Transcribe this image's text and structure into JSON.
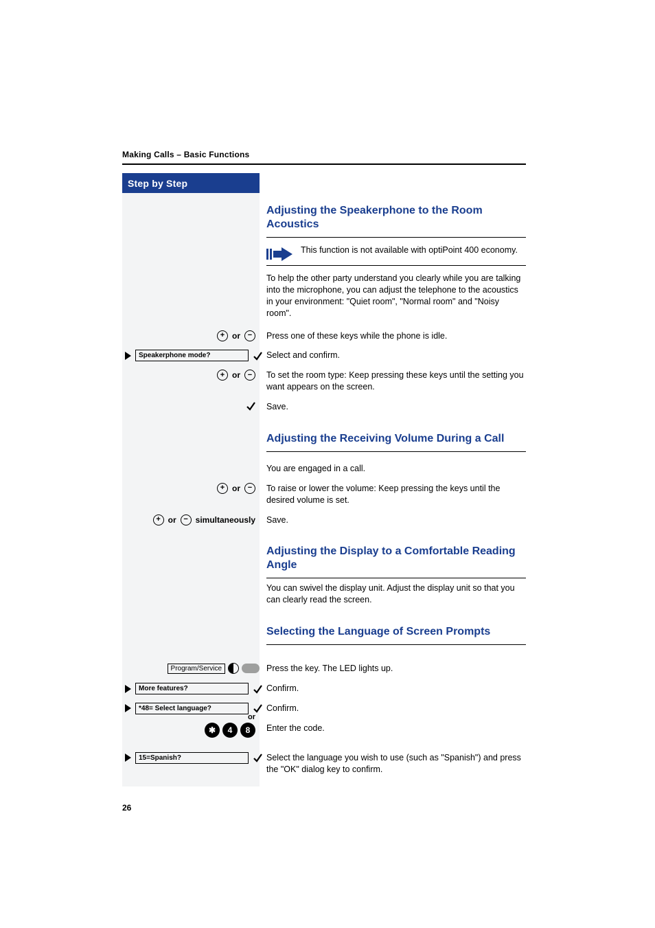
{
  "running_head": "Making Calls – Basic Functions",
  "step_heading": "Step by Step",
  "page_number": "26",
  "sections": {
    "s1": {
      "title": "Adjusting the Speakerphone to the Room Acoustics",
      "note": "This function is not available with optiPoint 400 economy.",
      "intro": "To help the other party understand you clearly while you are talking into the microphone, you can adjust the telephone to the acoustics in your environment: \"Quiet room\", \"Normal room\" and \"Noisy room\".",
      "step1": "Press one of these keys while the phone is idle.",
      "disp1": "Speakerphone mode?",
      "step2": "Select and confirm.",
      "step3": "To set the room type: Keep pressing these keys until the setting you want appears on the screen.",
      "step4": "Save."
    },
    "s2": {
      "title": "Adjusting the Receiving Volume During a Call",
      "intro": "You are engaged in a call.",
      "step1": "To raise or lower the volume: Keep pressing the keys until the desired volume is set.",
      "simul_label": "simultaneously",
      "step2": "Save."
    },
    "s3": {
      "title": "Adjusting the Display to a Comfortable Reading Angle",
      "intro": "You can swivel the display unit. Adjust the display unit so that you can clearly read the screen."
    },
    "s4": {
      "title": "Selecting the Language of Screen Prompts",
      "key_label": "Program/Service",
      "step1": "Press the key. The LED lights up.",
      "disp1": "More features?",
      "step2": "Confirm.",
      "disp2": "*48= Select language?",
      "step3": "Confirm.",
      "or_label": "or",
      "code_keys": [
        "✱",
        "4",
        "8"
      ],
      "step4": "Enter the code.",
      "disp3": "15=Spanish?",
      "step5": "Select the language you wish to use (such as \"Spanish\") and press the \"OK\" dialog key to confirm."
    }
  },
  "glyphs": {
    "or": "or"
  }
}
